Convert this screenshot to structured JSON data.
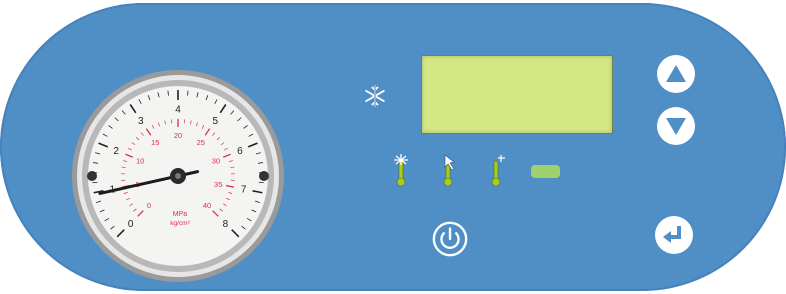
{
  "colors": {
    "panel": "#4f8fc6",
    "lcd": "#d5e685",
    "button": "#ffffff",
    "button_glyph": "#4f8fc6",
    "led": "#9fd06e",
    "indicator": "#aacc22",
    "gauge_red": "#d8324a"
  },
  "gauge": {
    "unit_primary": "MPa",
    "unit_secondary": "kg/cm²",
    "outer_labels": [
      "0",
      "1",
      "2",
      "3",
      "4",
      "5",
      "6",
      "7",
      "8"
    ],
    "inner_labels": [
      "0",
      "5",
      "10",
      "15",
      "20",
      "25",
      "30",
      "35",
      "40"
    ],
    "needle_reading_fraction": 0.12
  },
  "display": {
    "text": ""
  },
  "icons": {
    "snow": "snowflake-icon",
    "thermometers": [
      "thermometer-fan-icon",
      "thermometer-arrow-icon",
      "thermometer-small-icon"
    ],
    "up": "arrow-up-icon",
    "down": "arrow-down-icon",
    "power": "power-icon",
    "enter": "enter-icon"
  }
}
